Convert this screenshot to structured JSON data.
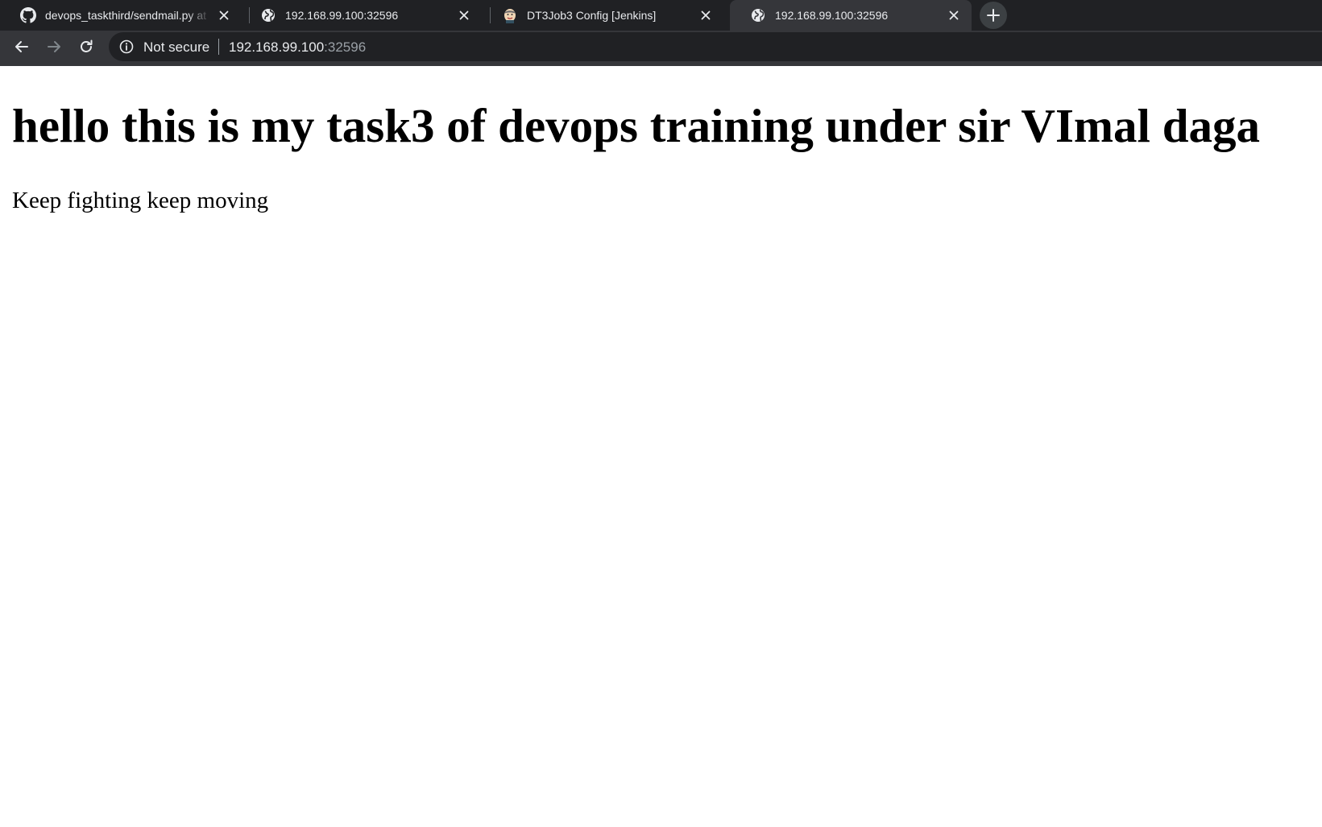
{
  "browser": {
    "tabs": [
      {
        "title": "devops_taskthird/sendmail.py at",
        "icon": "github-icon",
        "active": false
      },
      {
        "title": "192.168.99.100:32596",
        "icon": "globe-icon",
        "active": false
      },
      {
        "title": "DT3Job3 Config [Jenkins]",
        "icon": "jenkins-icon",
        "active": false
      },
      {
        "title": "192.168.99.100:32596",
        "icon": "globe-icon",
        "active": true
      }
    ],
    "address_bar": {
      "security_label": "Not secure",
      "url_host": "192.168.99.100",
      "url_port": ":32596"
    },
    "colors": {
      "tab_strip": "#202124",
      "active_tab": "#35363a",
      "omnibox": "#202124",
      "text": "#e8eaed",
      "muted_text": "#9aa0a6"
    }
  },
  "page": {
    "heading": "hello this is my task3 of devops training under sir VImal daga",
    "paragraph": "Keep fighting keep moving"
  }
}
